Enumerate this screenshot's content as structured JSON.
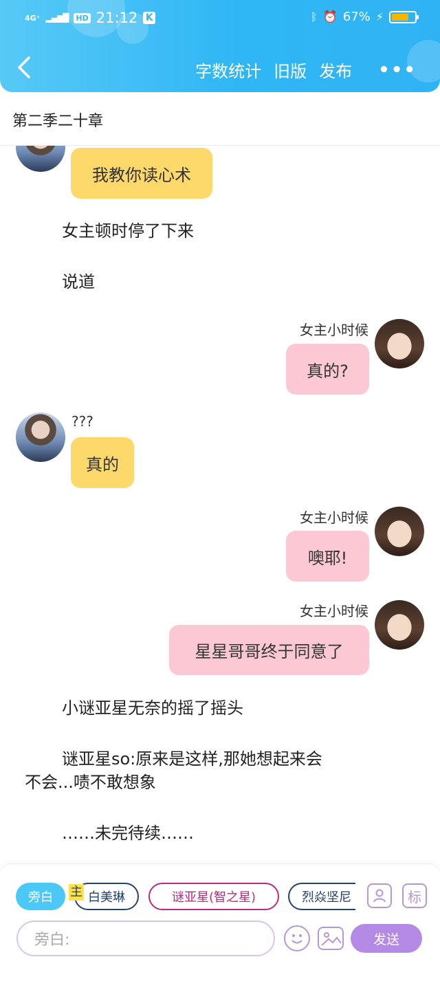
{
  "status_bar": {
    "network": "4G⁺",
    "hd": "HD",
    "time": "21:12",
    "k_badge": "K",
    "battery_percent": "67%",
    "battery_level": 0.67,
    "icons": [
      "bluetooth-icon",
      "alarm-icon",
      "charging-icon"
    ]
  },
  "nav": {
    "back_icon": "chevron-left-icon",
    "word_count": "字数统计",
    "old_version": "旧版",
    "publish": "发布",
    "more": "•••"
  },
  "chapter_title": "第二季二十章",
  "messages": {
    "m1_text": "我教你读心术",
    "n1": "女主顿时停了下来",
    "n2": "说道",
    "m2_speaker": "女主小时候",
    "m2_text": "真的?",
    "m3_speaker": "???",
    "m3_text": "真的",
    "m4_speaker": "女主小时候",
    "m4_text": "噢耶!",
    "m5_speaker": "女主小时候",
    "m5_text": "星星哥哥终于同意了",
    "n3": "小谜亚星无奈的摇了摇头",
    "n4_line1": "谜亚星so:原来是这样,那她想起来会",
    "n4_line2": "不会...啧不敢想象",
    "n5": "……未完待续……"
  },
  "bottom": {
    "chips": {
      "narrator": "旁白",
      "main_tag": "主",
      "c1": "白美琳",
      "c2": "谜亚星(智之星)",
      "c3": "烈焱坚尼"
    },
    "mark_label": "标",
    "input_placeholder": "旁白:",
    "send": "发送"
  },
  "colors": {
    "header": "#30b3f4",
    "yellow_bubble": "#fdd96b",
    "pink_bubble": "#fbc8d3",
    "send_button": "#b58ae6"
  }
}
